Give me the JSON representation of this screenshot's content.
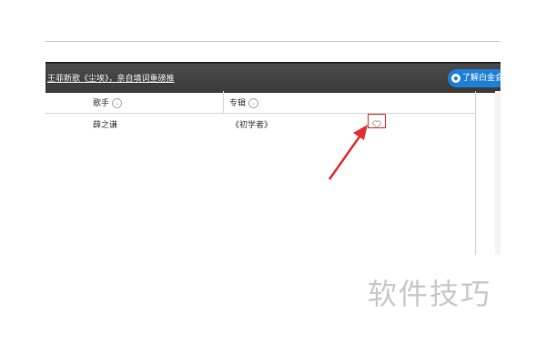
{
  "banner": {
    "link_text": "王菲新歌《尘埃》，亲自填词重磅推",
    "vip_button_label": "了解白金会员"
  },
  "table": {
    "columns": [
      {
        "label": "歌手"
      },
      {
        "label": "专辑"
      }
    ],
    "rows": [
      {
        "singer": "薛之谦",
        "album": "《初学者》"
      }
    ]
  },
  "watermark": "软件技巧",
  "colors": {
    "banner_bg": "#3a3a3a",
    "accent_blue": "#1e7fd6",
    "annotation_red": "#e23030"
  },
  "icons": [
    "heart-icon",
    "sort-icon",
    "diamond-icon",
    "arrow-annotation"
  ]
}
